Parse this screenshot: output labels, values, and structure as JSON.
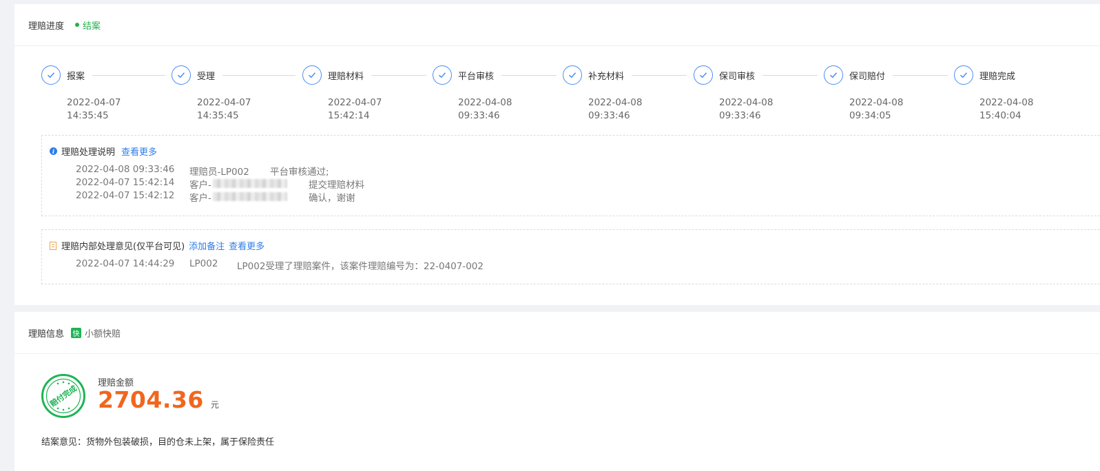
{
  "progress": {
    "title": "理赔进度",
    "status": "结案",
    "steps": [
      {
        "title": "报案",
        "date": "2022-04-07",
        "time": "14:35:45"
      },
      {
        "title": "受理",
        "date": "2022-04-07",
        "time": "14:35:45"
      },
      {
        "title": "理赔材料",
        "date": "2022-04-07",
        "time": "15:42:14"
      },
      {
        "title": "平台审核",
        "date": "2022-04-08",
        "time": "09:33:46"
      },
      {
        "title": "补充材料",
        "date": "2022-04-08",
        "time": "09:33:46"
      },
      {
        "title": "保司审核",
        "date": "2022-04-08",
        "time": "09:33:46"
      },
      {
        "title": "保司赔付",
        "date": "2022-04-08",
        "time": "09:34:05"
      },
      {
        "title": "理赔完成",
        "date": "2022-04-08",
        "time": "15:40:04"
      }
    ],
    "notes": {
      "title": "理赔处理说明",
      "more": "查看更多",
      "rows": [
        {
          "time": "2022-04-08 09:33:46",
          "who": "理赔员-LP002",
          "action": "平台审核通过;"
        },
        {
          "time": "2022-04-07 15:42:14",
          "who": "客户-",
          "action": "提交理赔材料"
        },
        {
          "time": "2022-04-07 15:42:12",
          "who": "客户-",
          "action": "确认，谢谢"
        }
      ]
    },
    "internal": {
      "title": "理赔内部处理意见(仅平台可见)",
      "add": "添加备注",
      "more": "查看更多",
      "rows": [
        {
          "time": "2022-04-07 14:44:29",
          "who": "LP002",
          "action": "LP002受理了理赔案件，该案件理赔编号为：22-0407-002"
        }
      ]
    }
  },
  "info": {
    "title": "理赔信息",
    "fast_tag": "快",
    "fast_label": "小额快赔",
    "stamp_text": "赔付完成",
    "amount_label": "理赔金额",
    "amount": "2704.36",
    "unit": "元",
    "verdict": "结案意见：货物外包装破损，目的仓未上架，属于保险责任"
  },
  "colors": {
    "accent": "#2f7ee8",
    "success": "#22b14c",
    "amount": "#f1661e",
    "internal_icon": "#f2a14a"
  }
}
